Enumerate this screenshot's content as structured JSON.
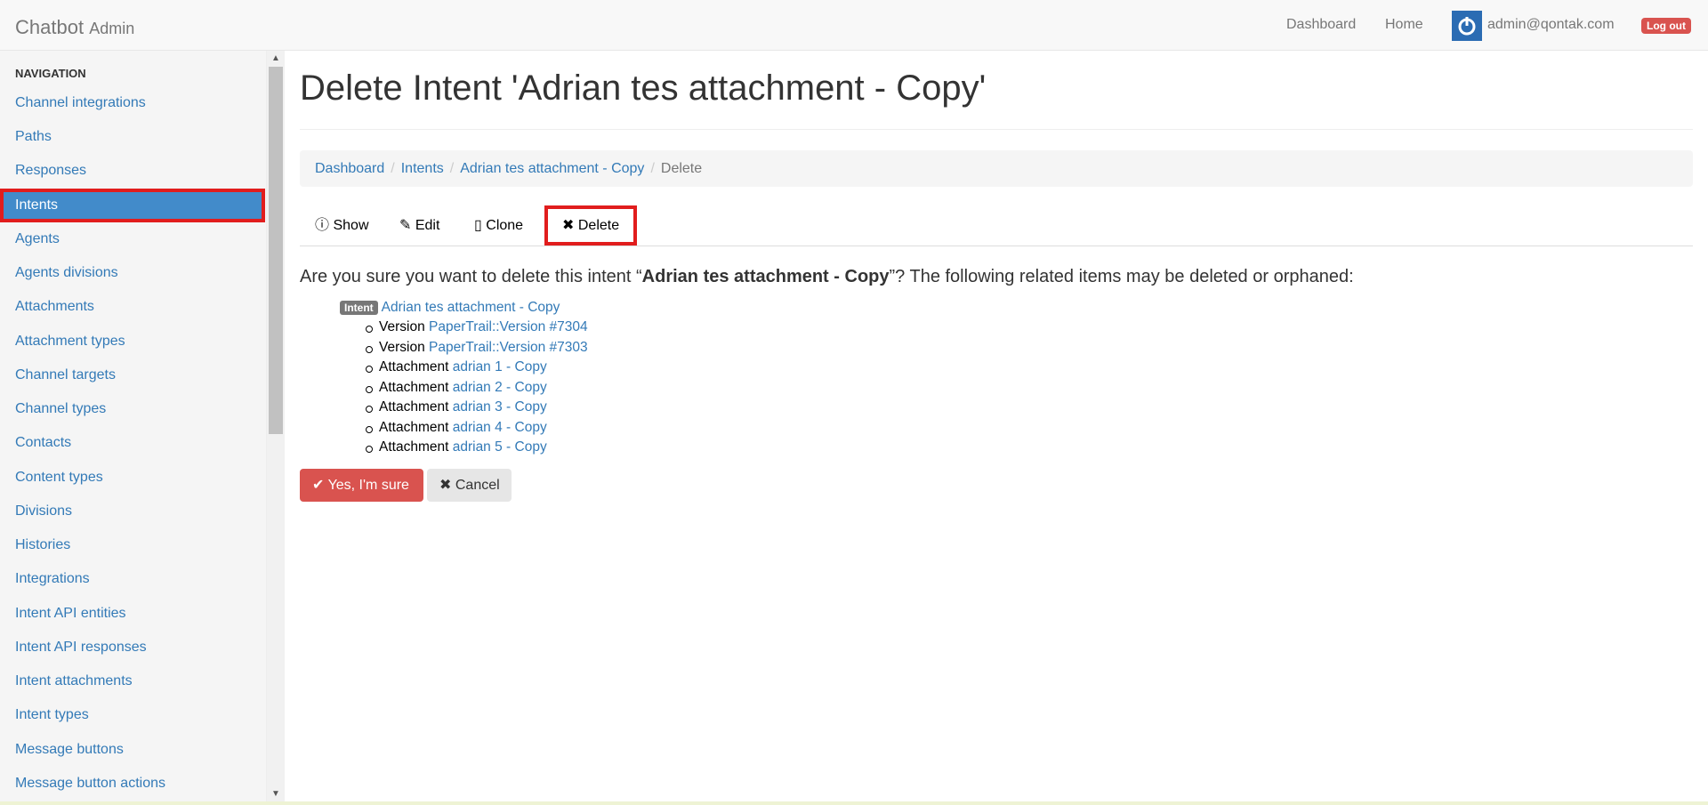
{
  "navbar": {
    "brand": "Chatbot",
    "brand_sub": "Admin",
    "links": [
      "Dashboard",
      "Home"
    ],
    "user": "admin@qontak.com",
    "logout": "Log out"
  },
  "sidebar": {
    "header": "NAVIGATION",
    "items": [
      "Channel integrations",
      "Paths",
      "Responses",
      "Intents",
      "Agents",
      "Agents divisions",
      "Attachments",
      "Attachment types",
      "Channel targets",
      "Channel types",
      "Contacts",
      "Content types",
      "Divisions",
      "Histories",
      "Integrations",
      "Intent API entities",
      "Intent API responses",
      "Intent attachments",
      "Intent types",
      "Message buttons",
      "Message button actions"
    ],
    "active": "Intents"
  },
  "page": {
    "title": "Delete Intent 'Adrian tes attachment - Copy'",
    "breadcrumb": [
      "Dashboard",
      "Intents",
      "Adrian tes attachment - Copy",
      "Delete"
    ],
    "tabs": [
      "Show",
      "Edit",
      "Clone",
      "Delete"
    ],
    "confirm_prefix": "Are you sure you want to delete this intent “",
    "confirm_name": "Adrian tes attachment - Copy",
    "confirm_suffix": "”? The following related items may be deleted or orphaned:",
    "tree": {
      "label": "Intent",
      "link": "Adrian tes attachment - Copy",
      "children": [
        {
          "type": "Version",
          "link": "PaperTrail::Version #7304"
        },
        {
          "type": "Version",
          "link": "PaperTrail::Version #7303"
        },
        {
          "type": "Attachment",
          "link": "adrian 1 - Copy"
        },
        {
          "type": "Attachment",
          "link": "adrian 2 - Copy"
        },
        {
          "type": "Attachment",
          "link": "adrian 3 - Copy"
        },
        {
          "type": "Attachment",
          "link": "adrian 4 - Copy"
        },
        {
          "type": "Attachment",
          "link": "adrian 5 - Copy"
        }
      ]
    },
    "buttons": {
      "confirm": "Yes, I'm sure",
      "cancel": "Cancel"
    }
  },
  "colors": {
    "primary": "#428bca",
    "danger": "#d9534f",
    "highlight": "#e11d1d",
    "link": "#337ab7"
  }
}
